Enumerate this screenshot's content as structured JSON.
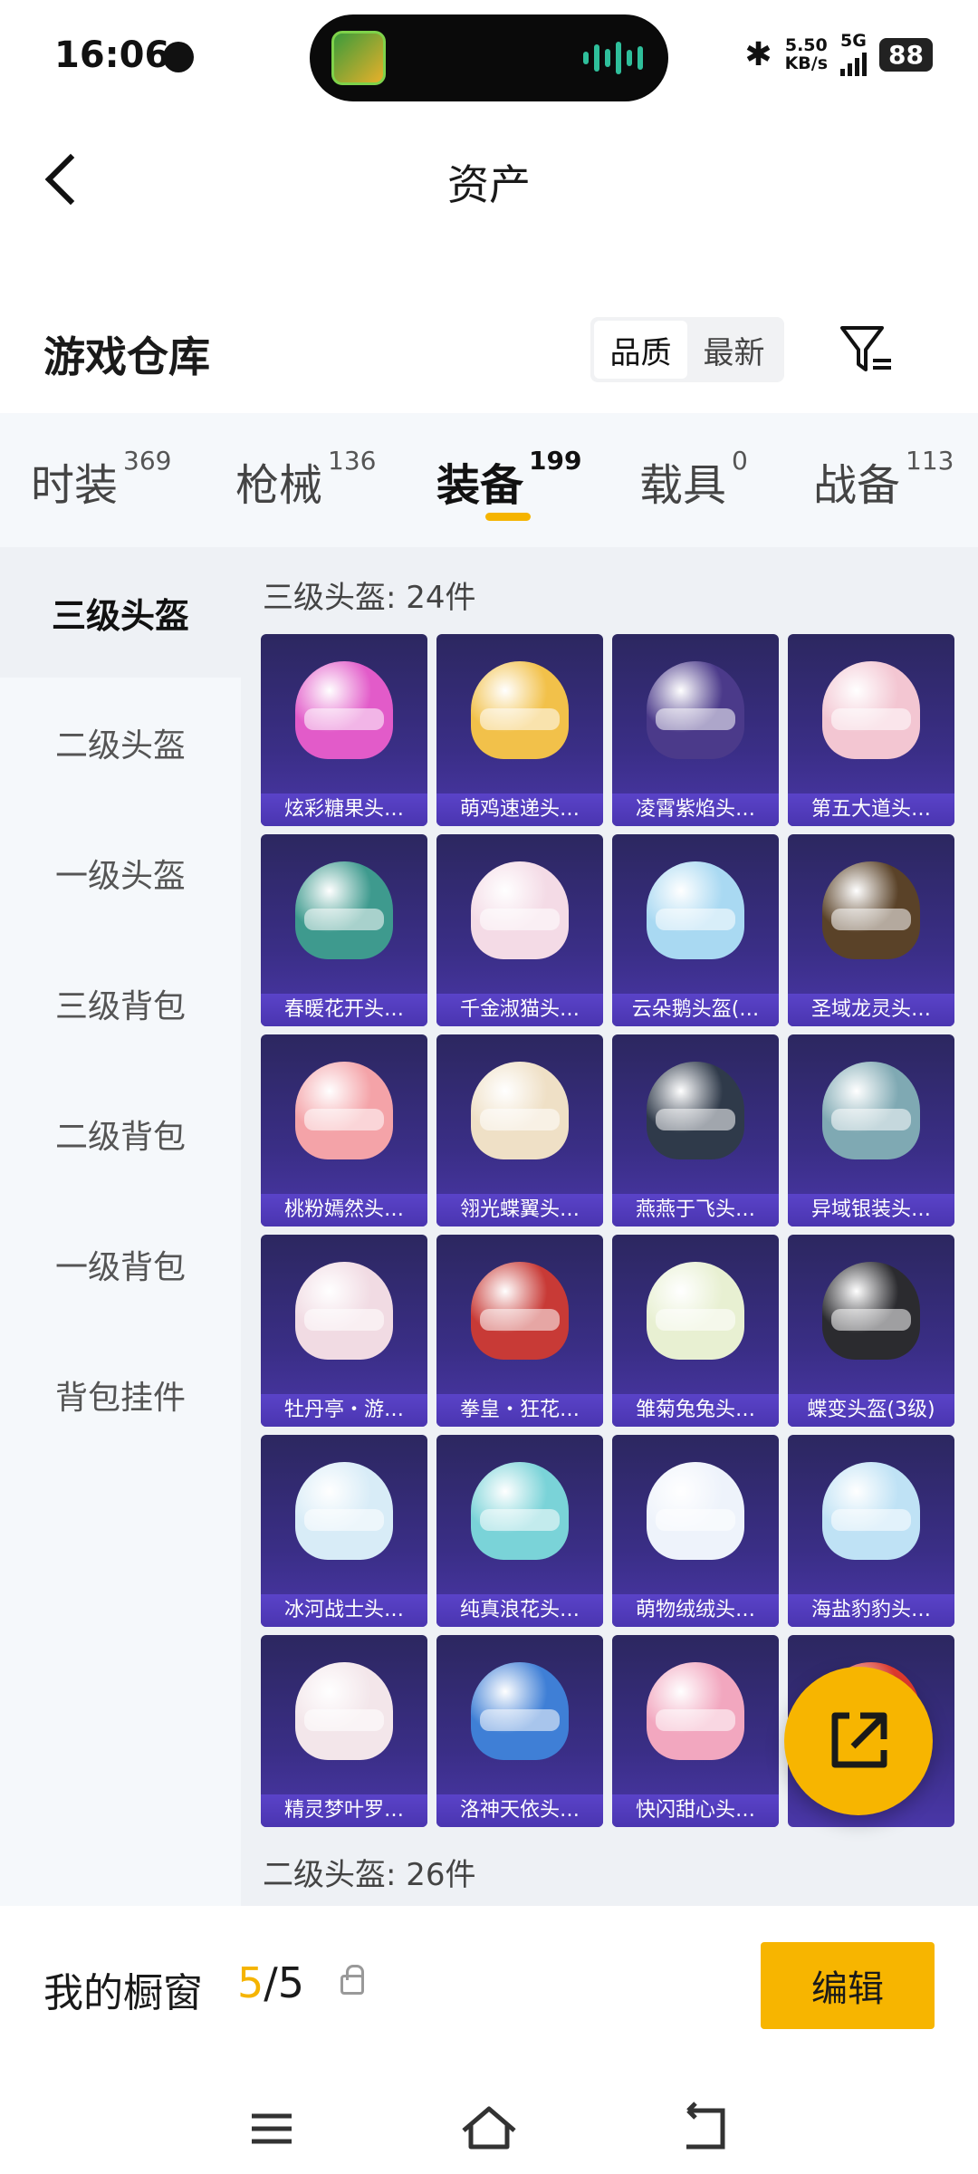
{
  "status_bar": {
    "time": "16:06",
    "speed_value": "5.50",
    "speed_unit": "KB/s",
    "network": "5G",
    "battery": "88"
  },
  "header": {
    "title": "资产"
  },
  "section": {
    "title": "游戏仓库",
    "sort_options": [
      "品质",
      "最新"
    ],
    "active_sort": "品质"
  },
  "categories": [
    {
      "name": "时装",
      "count": "369"
    },
    {
      "name": "枪械",
      "count": "136"
    },
    {
      "name": "装备",
      "count": "199"
    },
    {
      "name": "载具",
      "count": "0"
    },
    {
      "name": "战备",
      "count": "113"
    }
  ],
  "active_category": "装备",
  "sidebar": [
    "三级头盔",
    "二级头盔",
    "一级头盔",
    "三级背包",
    "二级背包",
    "一级背包",
    "背包挂件"
  ],
  "active_sidebar": "三级头盔",
  "groups": [
    {
      "title": "三级头盔: 24件"
    },
    {
      "title": "二级头盔: 26件"
    }
  ],
  "items": [
    {
      "name": "炫彩糖果头…",
      "color": "#e25bc9"
    },
    {
      "name": "萌鸡速递头…",
      "color": "#f2c14a"
    },
    {
      "name": "凌霄紫焰头…",
      "color": "#4b3a8a"
    },
    {
      "name": "第五大道头…",
      "color": "#f3c6d2"
    },
    {
      "name": "春暖花开头…",
      "color": "#3e9a8e"
    },
    {
      "name": "千金淑猫头…",
      "color": "#f4dbe6"
    },
    {
      "name": "云朵鹅头盔(…",
      "color": "#a9d9f2"
    },
    {
      "name": "圣域龙灵头…",
      "color": "#5a4228"
    },
    {
      "name": "桃粉嫣然头…",
      "color": "#f4a3a8"
    },
    {
      "name": "翎光蝶翼头…",
      "color": "#efe0c6"
    },
    {
      "name": "燕燕于飞头…",
      "color": "#2f3a4a"
    },
    {
      "name": "异域银装头…",
      "color": "#7fa9b3"
    },
    {
      "name": "牡丹亭・游…",
      "color": "#f1dbe3"
    },
    {
      "name": "拳皇・狂花…",
      "color": "#c83a36"
    },
    {
      "name": "雏菊兔兔头…",
      "color": "#e8f0d2"
    },
    {
      "name": "蝶变头盔(3级)",
      "color": "#2b2b2f"
    },
    {
      "name": "冰河战士头…",
      "color": "#d8ecf7"
    },
    {
      "name": "纯真浪花头…",
      "color": "#7ad3d8"
    },
    {
      "name": "萌物绒绒头…",
      "color": "#eef3fb"
    },
    {
      "name": "海盐豹豹头…",
      "color": "#bfe2f5"
    },
    {
      "name": "精灵梦叶罗…",
      "color": "#f3e6ea"
    },
    {
      "name": "洛神天依头…",
      "color": "#3f7fd6"
    },
    {
      "name": "快闪甜心头…",
      "color": "#f2a7bf"
    },
    {
      "name": "",
      "color": "#e23b2e"
    }
  ],
  "showcase": {
    "label": "我的橱窗",
    "current": "5",
    "total": "/5",
    "edit_label": "编辑"
  },
  "icons": [
    "back-icon",
    "filter-icon",
    "share-icon",
    "lock-icon",
    "menu-icon",
    "home-icon",
    "return-icon"
  ]
}
